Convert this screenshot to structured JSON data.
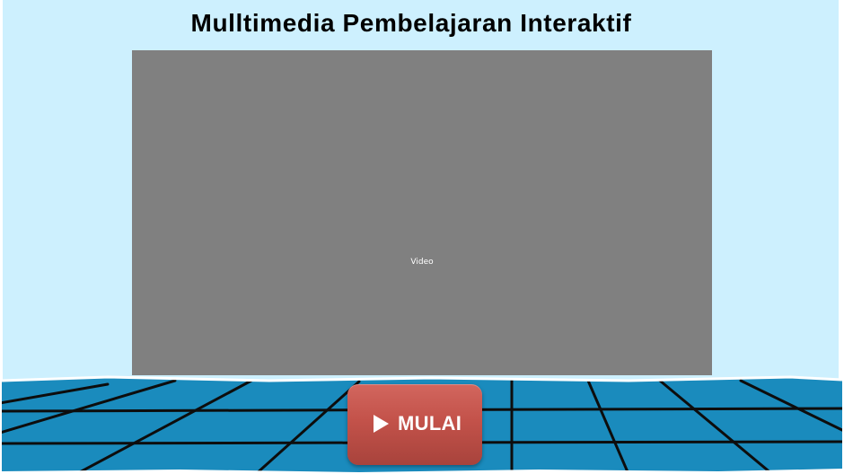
{
  "page": {
    "title": "Mulltimedia Pembelajaran Interaktif"
  },
  "video": {
    "label": "Video"
  },
  "start_button": {
    "label": "MULAI",
    "icon": "play-icon"
  },
  "colors": {
    "wall": "#cdf0fe",
    "floor": "#1a8bbd",
    "video_placeholder": "#808080",
    "button": "#c3524a"
  }
}
